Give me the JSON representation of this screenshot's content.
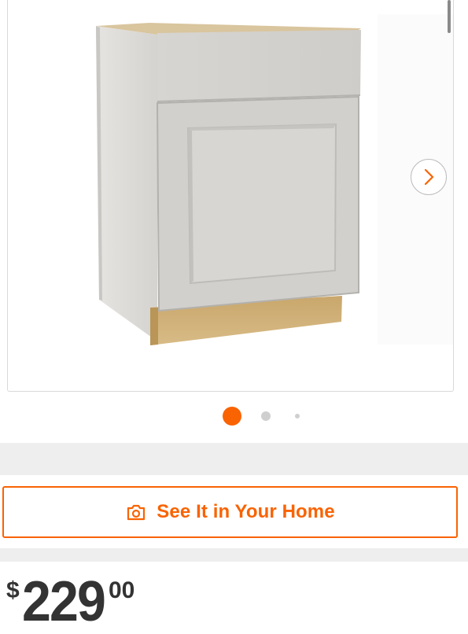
{
  "product": {
    "image_alt": "Shaker style base cabinet with drawer and door"
  },
  "gallery": {
    "total_images": 3,
    "active_index": 0
  },
  "cta": {
    "label": "See It in Your Home",
    "icon": "camera-icon"
  },
  "price": {
    "currency": "$",
    "dollars": "229",
    "cents": "00"
  },
  "colors": {
    "accent": "#f96302",
    "dot_inactive": "#cfcfcf",
    "band": "#eeeeee",
    "text": "#333333"
  }
}
